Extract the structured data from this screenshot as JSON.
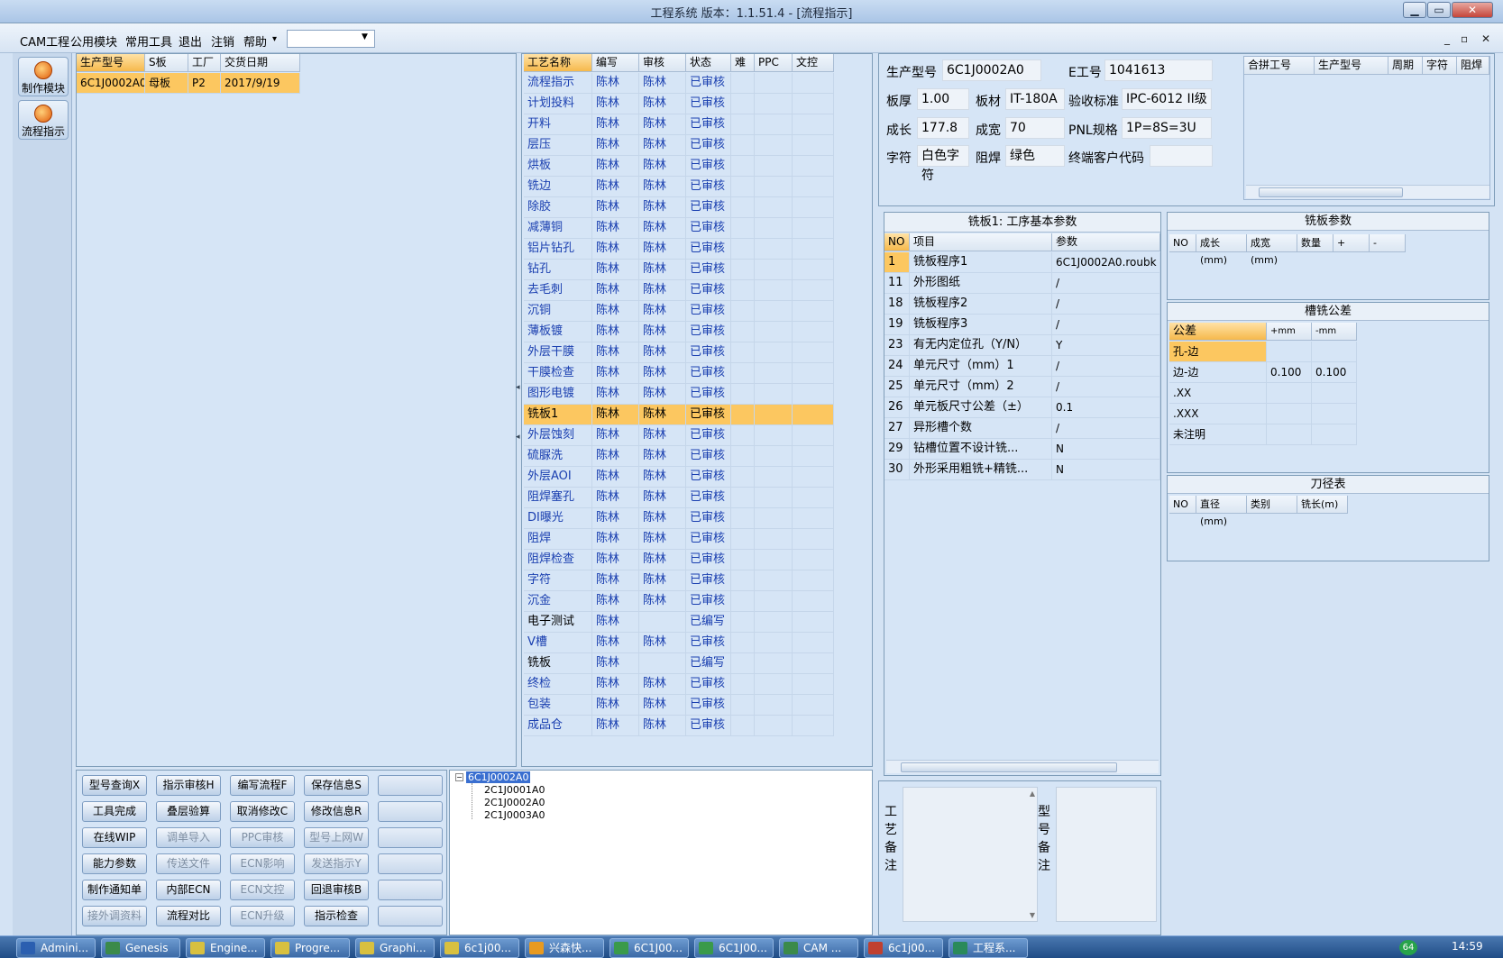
{
  "window": {
    "title": "工程系统   版本：1.1.51.4 - [流程指示]"
  },
  "menu": [
    "CAM工程",
    "公用模块",
    "常用工具",
    "退出",
    "注销",
    "帮助"
  ],
  "menu_help_arrow": "▾",
  "mdi_controls": [
    "_",
    "▫",
    "✕"
  ],
  "window_controls": [
    "▁",
    "▭",
    "✕"
  ],
  "sidebar": [
    {
      "label": "制作模块"
    },
    {
      "label": "流程指示"
    }
  ],
  "orders": {
    "headers": [
      "生产型号",
      "S板",
      "工厂",
      "交货日期"
    ],
    "rows": [
      [
        "6C1J0002A0",
        "母板",
        "P2",
        "2017/9/19"
      ]
    ]
  },
  "process": {
    "headers": [
      "工艺名称",
      "编写",
      "审核",
      "状态",
      "难",
      "PPC",
      "文控"
    ],
    "rows": [
      [
        "流程指示",
        "陈林",
        "陈林",
        "已审核"
      ],
      [
        "计划投料",
        "陈林",
        "陈林",
        "已审核"
      ],
      [
        "开料",
        "陈林",
        "陈林",
        "已审核"
      ],
      [
        "层压",
        "陈林",
        "陈林",
        "已审核"
      ],
      [
        "烘板",
        "陈林",
        "陈林",
        "已审核"
      ],
      [
        "铣边",
        "陈林",
        "陈林",
        "已审核"
      ],
      [
        "除胶",
        "陈林",
        "陈林",
        "已审核"
      ],
      [
        "减薄铜",
        "陈林",
        "陈林",
        "已审核"
      ],
      [
        "铝片钻孔",
        "陈林",
        "陈林",
        "已审核"
      ],
      [
        "钻孔",
        "陈林",
        "陈林",
        "已审核"
      ],
      [
        "去毛刺",
        "陈林",
        "陈林",
        "已审核"
      ],
      [
        "沉铜",
        "陈林",
        "陈林",
        "已审核"
      ],
      [
        "薄板镀",
        "陈林",
        "陈林",
        "已审核"
      ],
      [
        "外层干膜",
        "陈林",
        "陈林",
        "已审核"
      ],
      [
        "干膜检查",
        "陈林",
        "陈林",
        "已审核"
      ],
      [
        "图形电镀",
        "陈林",
        "陈林",
        "已审核"
      ],
      [
        "铣板1",
        "陈林",
        "陈林",
        "已审核"
      ],
      [
        "外层蚀刻",
        "陈林",
        "陈林",
        "已审核"
      ],
      [
        "硫脲洗",
        "陈林",
        "陈林",
        "已审核"
      ],
      [
        "外层AOI",
        "陈林",
        "陈林",
        "已审核"
      ],
      [
        "阻焊塞孔",
        "陈林",
        "陈林",
        "已审核"
      ],
      [
        "DI曝光",
        "陈林",
        "陈林",
        "已审核"
      ],
      [
        "阻焊",
        "陈林",
        "陈林",
        "已审核"
      ],
      [
        "阻焊检查",
        "陈林",
        "陈林",
        "已审核"
      ],
      [
        "字符",
        "陈林",
        "陈林",
        "已审核"
      ],
      [
        "沉金",
        "陈林",
        "陈林",
        "已审核"
      ],
      [
        "电子测试",
        "陈林",
        "",
        "已编写"
      ],
      [
        "V槽",
        "陈林",
        "陈林",
        "已审核"
      ],
      [
        "铣板",
        "陈林",
        "",
        "已编写"
      ],
      [
        "终检",
        "陈林",
        "陈林",
        "已审核"
      ],
      [
        "包装",
        "陈林",
        "陈林",
        "已审核"
      ],
      [
        "成品仓",
        "陈林",
        "陈林",
        "已审核"
      ]
    ],
    "selected_index": 16
  },
  "info": {
    "model_label": "生产型号",
    "model": "6C1J0002A0",
    "eno_label": "E工号",
    "eno": "1041613",
    "thick_label": "板厚",
    "thick": "1.00",
    "material_label": "板材",
    "material": "IT-180A",
    "standard_label": "验收标准",
    "standard": "IPC-6012 II级",
    "len_label": "成长",
    "len": "177.8",
    "wid_label": "成宽",
    "wid": "70",
    "pnl_label": "PNL规格",
    "pnl": "1P=8S=3U",
    "char_label": "字符",
    "char": "白色字符",
    "mask_label": "阻焊",
    "mask": "绿色",
    "cust_label": "终端客户代码",
    "cust": ""
  },
  "merge": {
    "headers": [
      "合拼工号",
      "生产型号",
      "周期",
      "字符",
      "阻焊"
    ]
  },
  "params": {
    "title": "铣板1: 工序基本参数",
    "headers": [
      "NO",
      "项目",
      "参数"
    ],
    "rows": [
      [
        "1",
        "铣板程序1",
        "6C1J0002A0.roubk"
      ],
      [
        "11",
        "外形图纸",
        "/"
      ],
      [
        "18",
        "铣板程序2",
        "/"
      ],
      [
        "19",
        "铣板程序3",
        "/"
      ],
      [
        "23",
        "有无内定位孔（Y/N）",
        "Y"
      ],
      [
        "24",
        "单元尺寸（mm）1",
        "/"
      ],
      [
        "25",
        "单元尺寸（mm）2",
        "/"
      ],
      [
        "26",
        "单元板尺寸公差（±）",
        "0.1"
      ],
      [
        "27",
        "异形槽个数",
        "/"
      ],
      [
        "29",
        "钻槽位置不设计铣...",
        "N"
      ],
      [
        "30",
        "外形采用粗铣+精铣...",
        "N"
      ]
    ]
  },
  "mill": {
    "title": "铣板参数",
    "headers": [
      "NO",
      "成长(mm)",
      "成宽(mm)",
      "数量",
      "+",
      "-"
    ]
  },
  "tol": {
    "title": "槽铣公差",
    "headers": [
      "公差",
      "+mm",
      "-mm"
    ],
    "rows": [
      [
        "孔-边",
        "",
        ""
      ],
      [
        "边-边",
        "0.100",
        "0.100"
      ],
      [
        ".XX",
        "",
        ""
      ],
      [
        ".XXX",
        "",
        ""
      ],
      [
        "未注明",
        "",
        ""
      ]
    ]
  },
  "tools": {
    "title": "刀径表",
    "headers": [
      "NO",
      "直径(mm)",
      "类别",
      "铣长(m)"
    ]
  },
  "tree": {
    "root": "6C1J0002A0",
    "children": [
      "2C1J0001A0",
      "2C1J0002A0",
      "2C1J0003A0"
    ]
  },
  "notes": {
    "process_label": "工艺备注",
    "model_label": "型号备注"
  },
  "buttons": [
    [
      {
        "t": "型号查询X",
        "d": false
      },
      {
        "t": "指示审核H",
        "d": false
      },
      {
        "t": "编写流程F",
        "d": false
      },
      {
        "t": "保存信息S",
        "d": false
      },
      {
        "t": "",
        "d": false
      }
    ],
    [
      {
        "t": "工具完成",
        "d": false
      },
      {
        "t": "叠层验算",
        "d": false
      },
      {
        "t": "取消修改C",
        "d": false
      },
      {
        "t": "修改信息R",
        "d": false
      },
      {
        "t": "",
        "d": false
      }
    ],
    [
      {
        "t": "在线WIP",
        "d": false
      },
      {
        "t": "调单导入",
        "d": true
      },
      {
        "t": "PPC审核",
        "d": true
      },
      {
        "t": "型号上网W",
        "d": true
      },
      {
        "t": "",
        "d": false
      }
    ],
    [
      {
        "t": "能力参数",
        "d": false
      },
      {
        "t": "传送文件",
        "d": true
      },
      {
        "t": "ECN影响",
        "d": true
      },
      {
        "t": "发送指示Y",
        "d": true
      },
      {
        "t": "",
        "d": false
      }
    ],
    [
      {
        "t": "制作通知单",
        "d": false
      },
      {
        "t": "内部ECN",
        "d": false
      },
      {
        "t": "ECN文控",
        "d": true
      },
      {
        "t": "回退审核B",
        "d": false
      },
      {
        "t": "",
        "d": false
      }
    ],
    [
      {
        "t": "接外调资料",
        "d": true
      },
      {
        "t": "流程对比",
        "d": false
      },
      {
        "t": "ECN升级",
        "d": true
      },
      {
        "t": "指示检查",
        "d": false
      },
      {
        "t": "",
        "d": false
      }
    ]
  ],
  "taskbar": {
    "items": [
      "Admini...",
      "Genesis",
      "Engine...",
      "Progre...",
      "Graphi...",
      "6c1j00...",
      "兴森快...",
      "6C1J00...",
      "6C1J00...",
      "CAM ...",
      "6c1j00...",
      "工程系..."
    ],
    "clock": "14:59",
    "badge": "64"
  },
  "colors": {
    "accent": "#f6b94c",
    "text_blue": "#1a3fb0",
    "panel": "#d6e5f6"
  }
}
